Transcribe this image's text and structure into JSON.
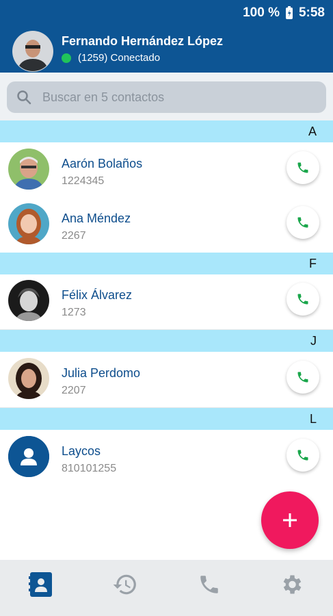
{
  "status_bar": {
    "battery": "100 %",
    "time": "5:58"
  },
  "header": {
    "name": "Fernando Hernández López",
    "status": "(1259) Conectado"
  },
  "search": {
    "placeholder": "Buscar en 5 contactos"
  },
  "sections": [
    {
      "letter": "A",
      "contacts": [
        {
          "name": "Aarón Bolaños",
          "number": "1224345"
        },
        {
          "name": "Ana Méndez",
          "number": "2267"
        }
      ]
    },
    {
      "letter": "F",
      "contacts": [
        {
          "name": "Félix Álvarez",
          "number": "1273"
        }
      ]
    },
    {
      "letter": "J",
      "contacts": [
        {
          "name": "Julia Perdomo",
          "number": "2207"
        }
      ]
    },
    {
      "letter": "L",
      "contacts": [
        {
          "name": "Laycos",
          "number": "810101255"
        }
      ]
    }
  ],
  "fab": {
    "icon": "plus-icon"
  },
  "nav": [
    "contacts-icon",
    "history-icon",
    "phone-icon",
    "settings-icon"
  ],
  "colors": {
    "primary": "#0d5594",
    "section": "#a9e7fb",
    "fab": "#f0195e",
    "online": "#20c45a",
    "call": "#1aa64b"
  }
}
